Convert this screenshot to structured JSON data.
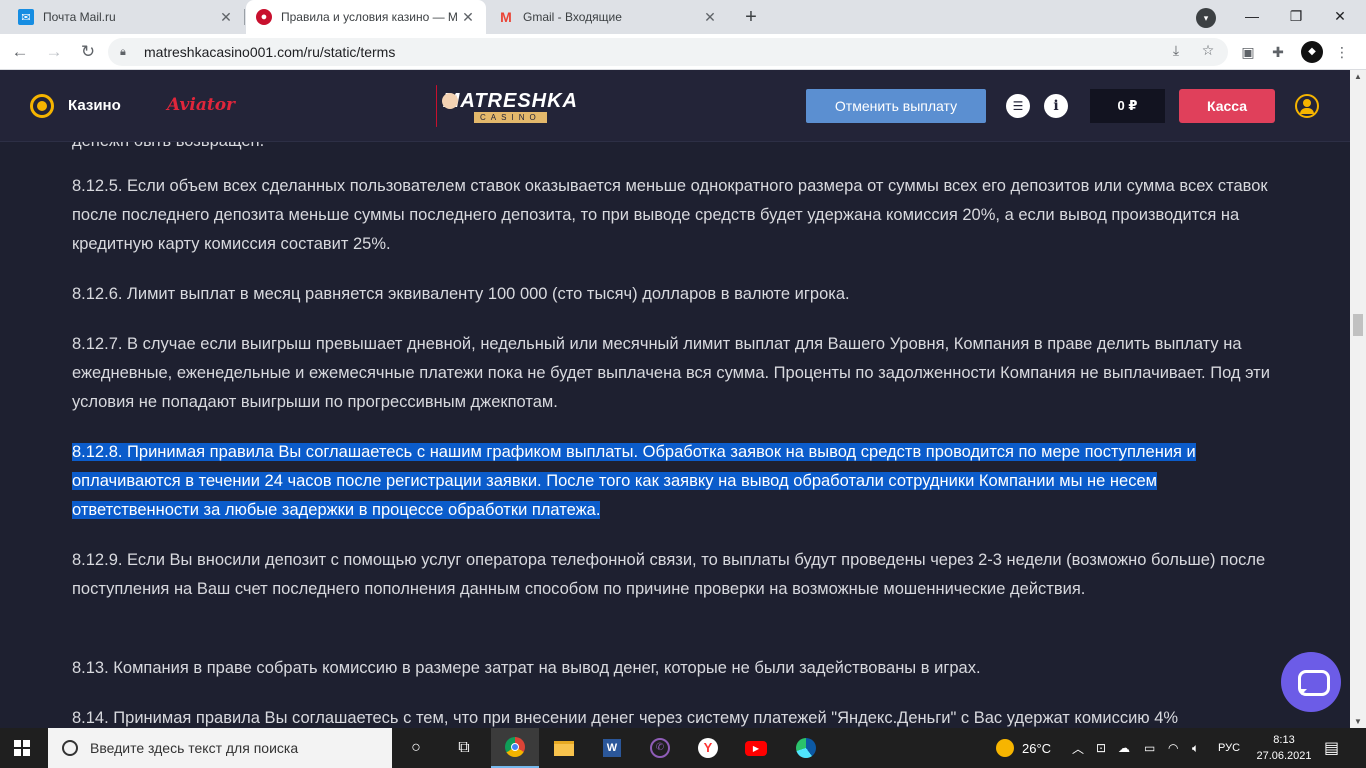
{
  "browser": {
    "tabs": [
      {
        "label": "Почта Mail.ru",
        "icon": "mail-icon"
      },
      {
        "label": "Правила и условия казино — M",
        "icon": "matreshka-favicon"
      },
      {
        "label": "Gmail - Входящие",
        "icon": "gmail-icon"
      }
    ],
    "url": "matreshkacasino001.com/ru/static/terms"
  },
  "header": {
    "casino_label": "Казино",
    "aviator_label": "Aviator",
    "logo_main": "MATRESHKA",
    "logo_sub": "CASINO",
    "cancel_payout_label": "Отменить выплату",
    "balance": "0 ₽",
    "cash_label": "Касса",
    "colors": {
      "accent": "#f5b400",
      "cash": "#e0405b",
      "cancel": "#5b8fd1",
      "bg": "#232438"
    }
  },
  "content": {
    "cut_line": "денежн быть возвращен.",
    "paragraphs": [
      {
        "text": "8.12.5. Если объем всех сделанных пользователем ставок оказывается меньше однократного размера от суммы всех его депозитов или сумма всех ставок после последнего депозита меньше суммы последнего депозита, то при выводе средств будет удержана комиссия 20%, а если вывод производится на кредитную карту комиссия составит 25%."
      },
      {
        "text": "8.12.6. Лимит выплат в месяц равняется эквиваленту 100 000 (сто тысяч) долларов в валюте игрока."
      },
      {
        "text": "8.12.7. В случае если выигрыш превышает дневной, недельный или месячный лимит выплат для Вашего Уровня, Компания в праве делить выплату на ежедневные, еженедельные и ежемесячные платежи пока не будет выплачена вся сумма. Проценты по задолженности Компания не выплачивает. Под эти условия не попадают выигрыши по прогрессивным джекпотам."
      },
      {
        "text": "8.12.8. Принимая правила Вы соглашаетесь с нашим графиком выплаты. Обработка заявок на вывод средств проводится по мере поступления и оплачиваются в течении 24 часов после регистрации заявки. После того как заявку на вывод обработали сотрудники Компании мы не несем ответственности за любые задержки в процессе обработки платежа.",
        "highlighted": true
      },
      {
        "text": "8.12.9. Если Вы вносили депозит с помощью услуг оператора телефонной связи, то выплаты будут проведены через 2-3 недели (возможно больше) после поступления на Ваш счет последнего пополнения данным способом по причине проверки на возможные мошеннические действия."
      },
      {
        "text": "8.13. Компания в праве собрать комиссию в размере затрат на вывод денег, которые не были задействованы в играх."
      },
      {
        "text": "8.14. Принимая правила Вы соглашаетесь с тем, что при внесении денег через систему платежей \"Яндекс.Деньги\" с Вас удержат комиссию 4%"
      }
    ]
  },
  "taskbar": {
    "search_placeholder": "Введите здесь текст для поиска",
    "weather": "26°C",
    "language": "РУС",
    "time": "8:13",
    "date": "27.06.2021"
  }
}
